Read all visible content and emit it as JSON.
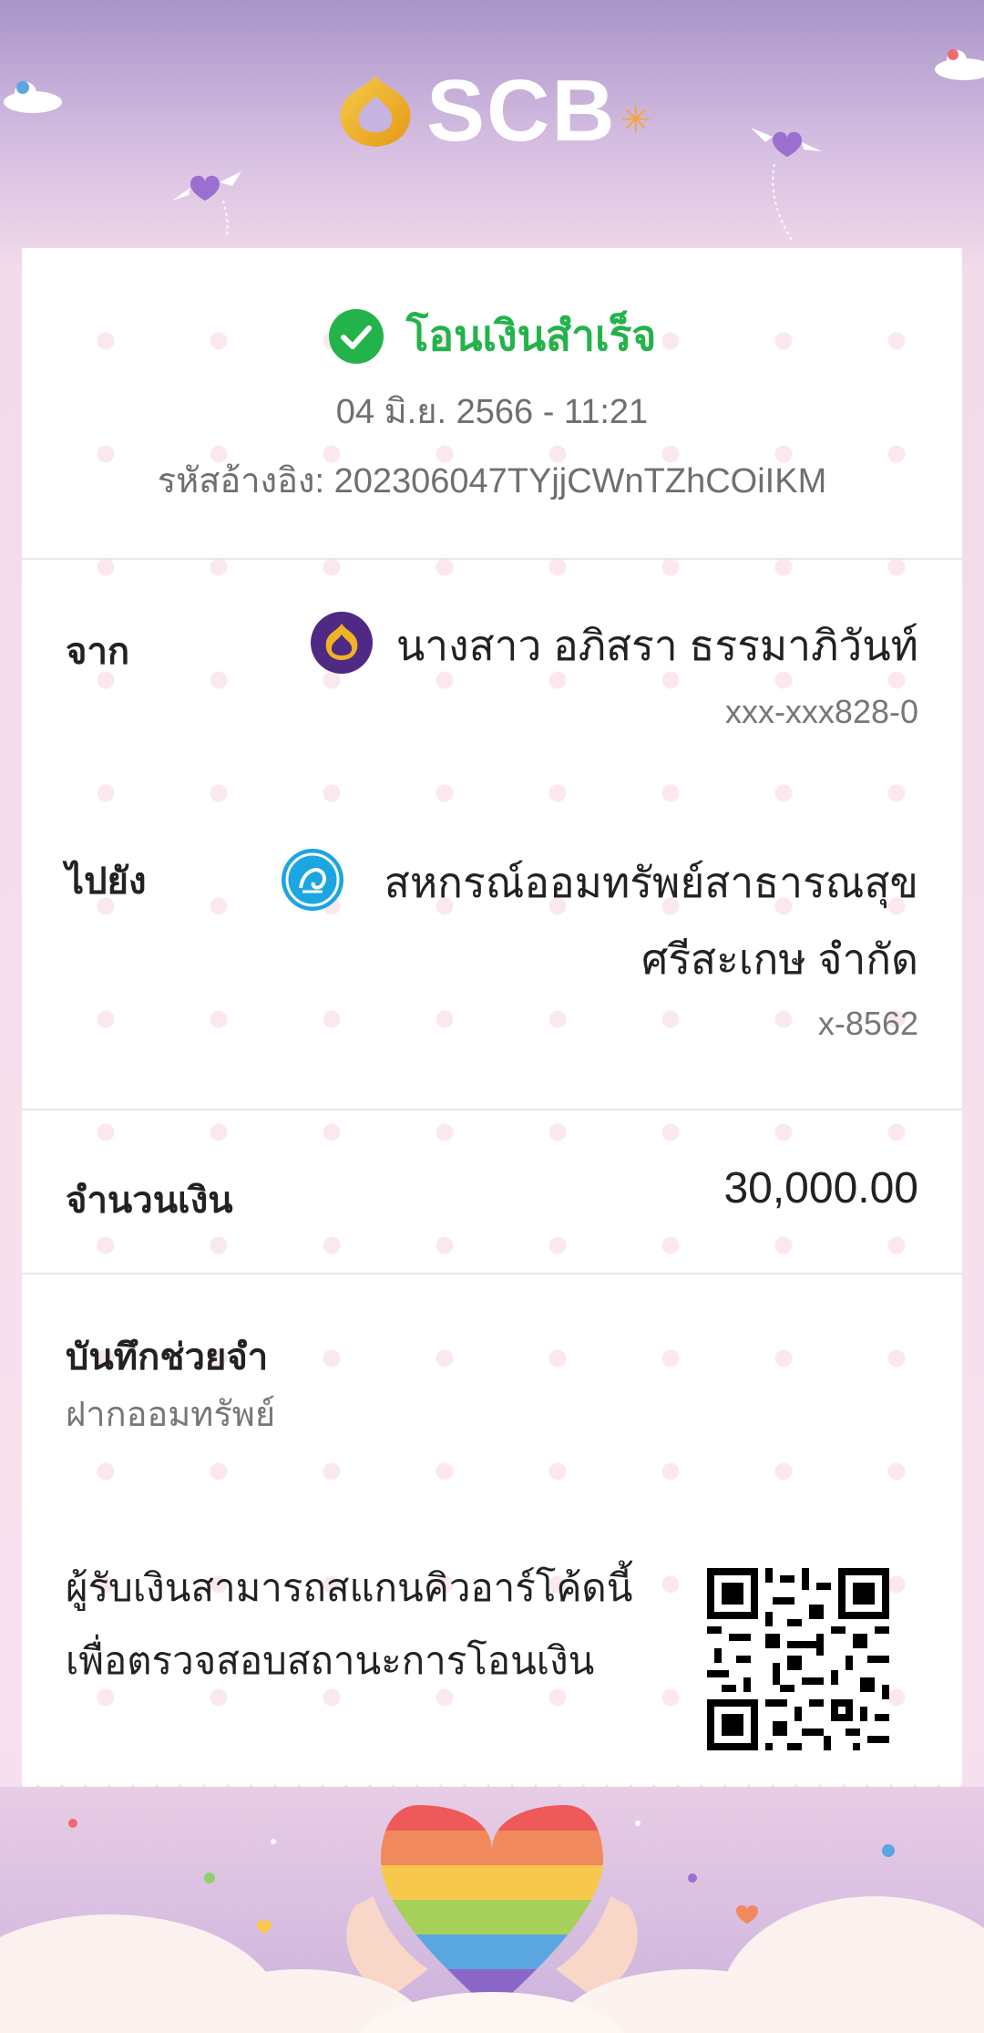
{
  "brand": {
    "name": "SCB"
  },
  "status": {
    "text": "โอนเงินสำเร็จ"
  },
  "datetime": "04 มิ.ย. 2566 - 11:21",
  "reference": "รหัสอ้างอิง: 202306047TYjjCWnTZhCOiIKM",
  "from": {
    "label": "จาก",
    "name": "นางสาว อภิสรา ธรรมาภิวันท์",
    "account": "xxx-xxx828-0",
    "bank_icon": "scb-bank-icon"
  },
  "to": {
    "label": "ไปยัง",
    "name_line1": "สหกรณ์ออมทรัพย์สาธารณสุข",
    "name_line2": "ศรีสะเกษ จำกัด",
    "account": "x-8562",
    "bank_icon": "krungthai-bank-icon"
  },
  "amount": {
    "label": "จำนวนเงิน",
    "value": "30,000.00"
  },
  "memo": {
    "label": "บันทึกช่วยจำ",
    "value": "ฝากออมทรัพย์"
  },
  "qr_note": {
    "line1": "ผู้รับเงินสามารถสแกนคิวอาร์โค้ดนี้",
    "line2": "เพื่อตรวจสอบสถานะการโอนเงิน"
  },
  "colors": {
    "success": "#23b34a",
    "scb_gold": "#f0b323",
    "scb_purple": "#4e2a84",
    "ktb_blue": "#1ba5e1"
  }
}
